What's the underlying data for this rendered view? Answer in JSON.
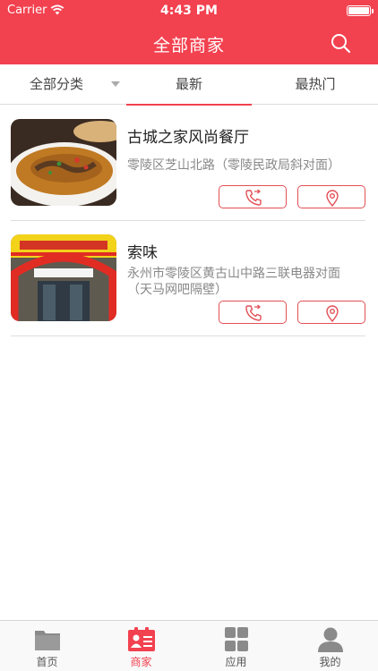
{
  "status_bar": {
    "carrier": "Carrier",
    "time": "4:43 PM",
    "battery_level": 1.0
  },
  "nav": {
    "title": "全部商家",
    "search_icon": "search-icon"
  },
  "filter_tabs": {
    "all": "全部分类",
    "latest": "最新",
    "hottest": "最热门",
    "active": "latest"
  },
  "merchants": [
    {
      "name": "古城之家风尚餐厅",
      "address": "零陵区芝山北路（零陵民政局斜对面）",
      "photo": "dish-photo",
      "actions": [
        "phone-icon",
        "location-pin-icon"
      ]
    },
    {
      "name": "索味",
      "address": "永州市零陵区黄古山中路三联电器对面（天马网吧隔壁）",
      "photo": "storefront-photo",
      "actions": [
        "phone-icon",
        "location-pin-icon"
      ]
    }
  ],
  "tabbar": {
    "items": [
      {
        "label": "首页",
        "icon": "folder-icon",
        "active": false
      },
      {
        "label": "商家",
        "icon": "merchant-card-icon",
        "active": true
      },
      {
        "label": "应用",
        "icon": "grid-icon",
        "active": false
      },
      {
        "label": "我的",
        "icon": "person-icon",
        "active": false
      }
    ]
  },
  "colors": {
    "accent": "#f2414f",
    "tab_inactive": "#555555",
    "text_secondary": "#888888"
  }
}
